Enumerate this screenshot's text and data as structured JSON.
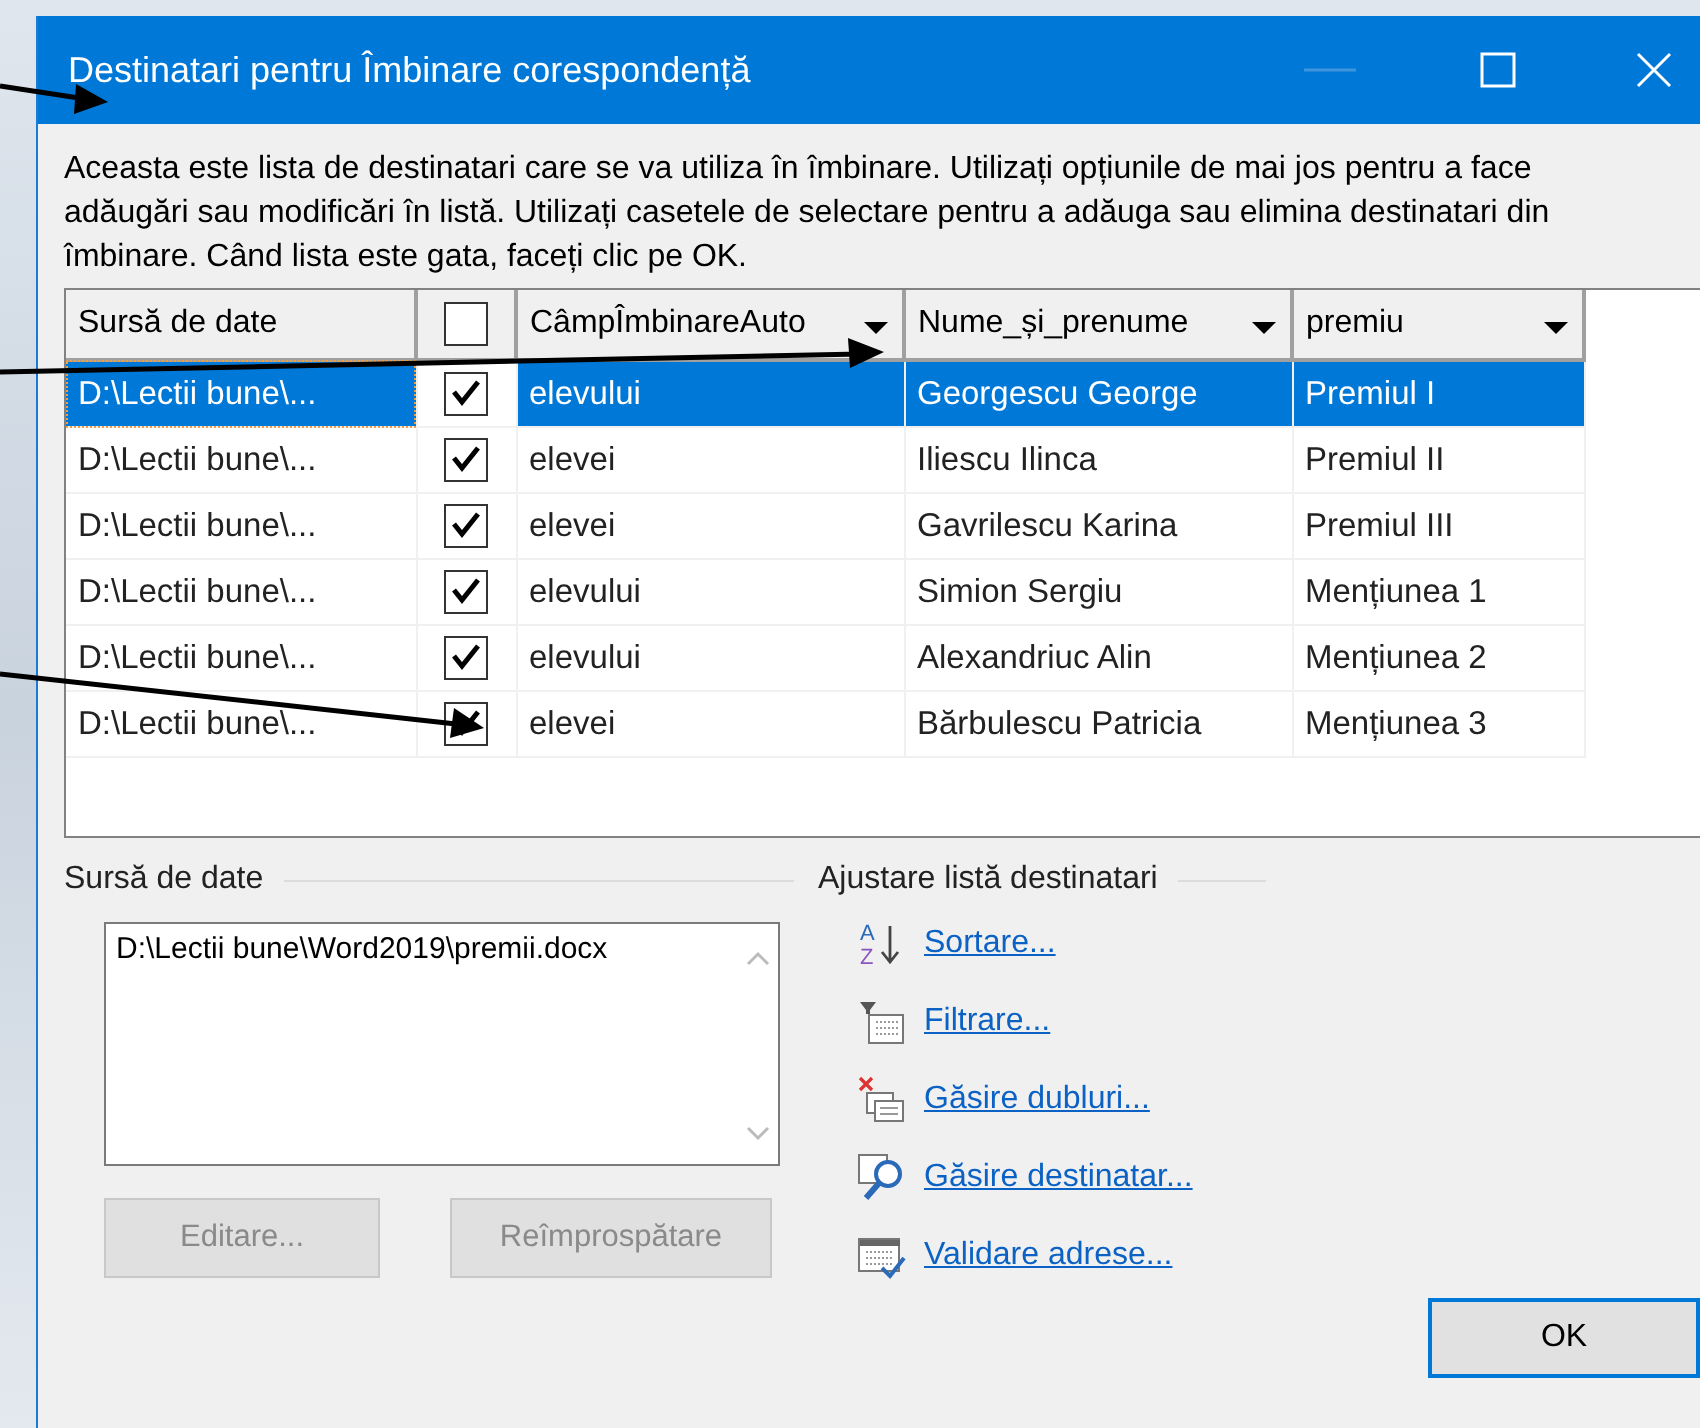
{
  "window": {
    "title": "Destinatari pentru Îmbinare corespondență",
    "minimize_disabled": true
  },
  "description": "Aceasta este lista de destinatari care se va utiliza în îmbinare. Utilizați opțiunile de mai jos pentru a face adăugări sau modificări în listă. Utilizați casetele de selectare pentru a adăuga sau elimina destinatari din îmbinare. Când lista este gata, faceți clic pe OK.",
  "table": {
    "all_checked": false,
    "columns": [
      {
        "kind": "text",
        "label": "Sursă de date",
        "dropdown": false
      },
      {
        "kind": "checkbox"
      },
      {
        "kind": "text",
        "label": "CâmpÎmbinareAuto",
        "dropdown": true
      },
      {
        "kind": "text",
        "label": "Nume_și_prenume",
        "dropdown": true
      },
      {
        "kind": "text",
        "label": "premiu",
        "dropdown": true
      }
    ],
    "rows": [
      {
        "cells": [
          {
            "text": "D:\\Lectii bune\\..."
          },
          {
            "checked": true
          },
          {
            "text": "elevului"
          },
          {
            "text": "Georgescu George"
          },
          {
            "text": "Premiul I"
          }
        ],
        "selected": true
      },
      {
        "cells": [
          {
            "text": "D:\\Lectii bune\\..."
          },
          {
            "checked": true
          },
          {
            "text": "elevei"
          },
          {
            "text": "Iliescu Ilinca"
          },
          {
            "text": "Premiul II"
          }
        ],
        "selected": false
      },
      {
        "cells": [
          {
            "text": "D:\\Lectii bune\\..."
          },
          {
            "checked": true
          },
          {
            "text": "elevei"
          },
          {
            "text": "Gavrilescu Karina"
          },
          {
            "text": "Premiul III"
          }
        ],
        "selected": false
      },
      {
        "cells": [
          {
            "text": "D:\\Lectii bune\\..."
          },
          {
            "checked": true
          },
          {
            "text": "elevului"
          },
          {
            "text": "Simion Sergiu"
          },
          {
            "text": "Mențiunea 1"
          }
        ],
        "selected": false
      },
      {
        "cells": [
          {
            "text": "D:\\Lectii bune\\..."
          },
          {
            "checked": true
          },
          {
            "text": "elevului"
          },
          {
            "text": "Alexandriuc Alin"
          },
          {
            "text": "Mențiunea 2"
          }
        ],
        "selected": false
      },
      {
        "cells": [
          {
            "text": "D:\\Lectii bune\\..."
          },
          {
            "checked": true
          },
          {
            "text": "elevei"
          },
          {
            "text": "Bărbulescu Patricia"
          },
          {
            "text": "Mențiunea 3"
          }
        ],
        "selected": false
      }
    ]
  },
  "data_source": {
    "label": "Sursă de date",
    "items": [
      "D:\\Lectii bune\\Word2019\\premii.docx"
    ],
    "buttons": [
      {
        "label": "Editare...",
        "disabled": true
      },
      {
        "label": "Reîmprospătare",
        "disabled": true
      }
    ]
  },
  "adjust": {
    "label": "Ajustare listă destinatari",
    "links": [
      {
        "label": "Sortare...",
        "kind": "sort",
        "icon_letters": [
          "A",
          "Z"
        ]
      },
      {
        "label": "Filtrare...",
        "kind": "filter"
      },
      {
        "label": "Găsire dubluri...",
        "kind": "duplicates"
      },
      {
        "label": "Găsire destinatar...",
        "kind": "find"
      },
      {
        "label": "Validare adrese...",
        "kind": "validate"
      }
    ]
  },
  "ok_button": {
    "label": "OK"
  }
}
